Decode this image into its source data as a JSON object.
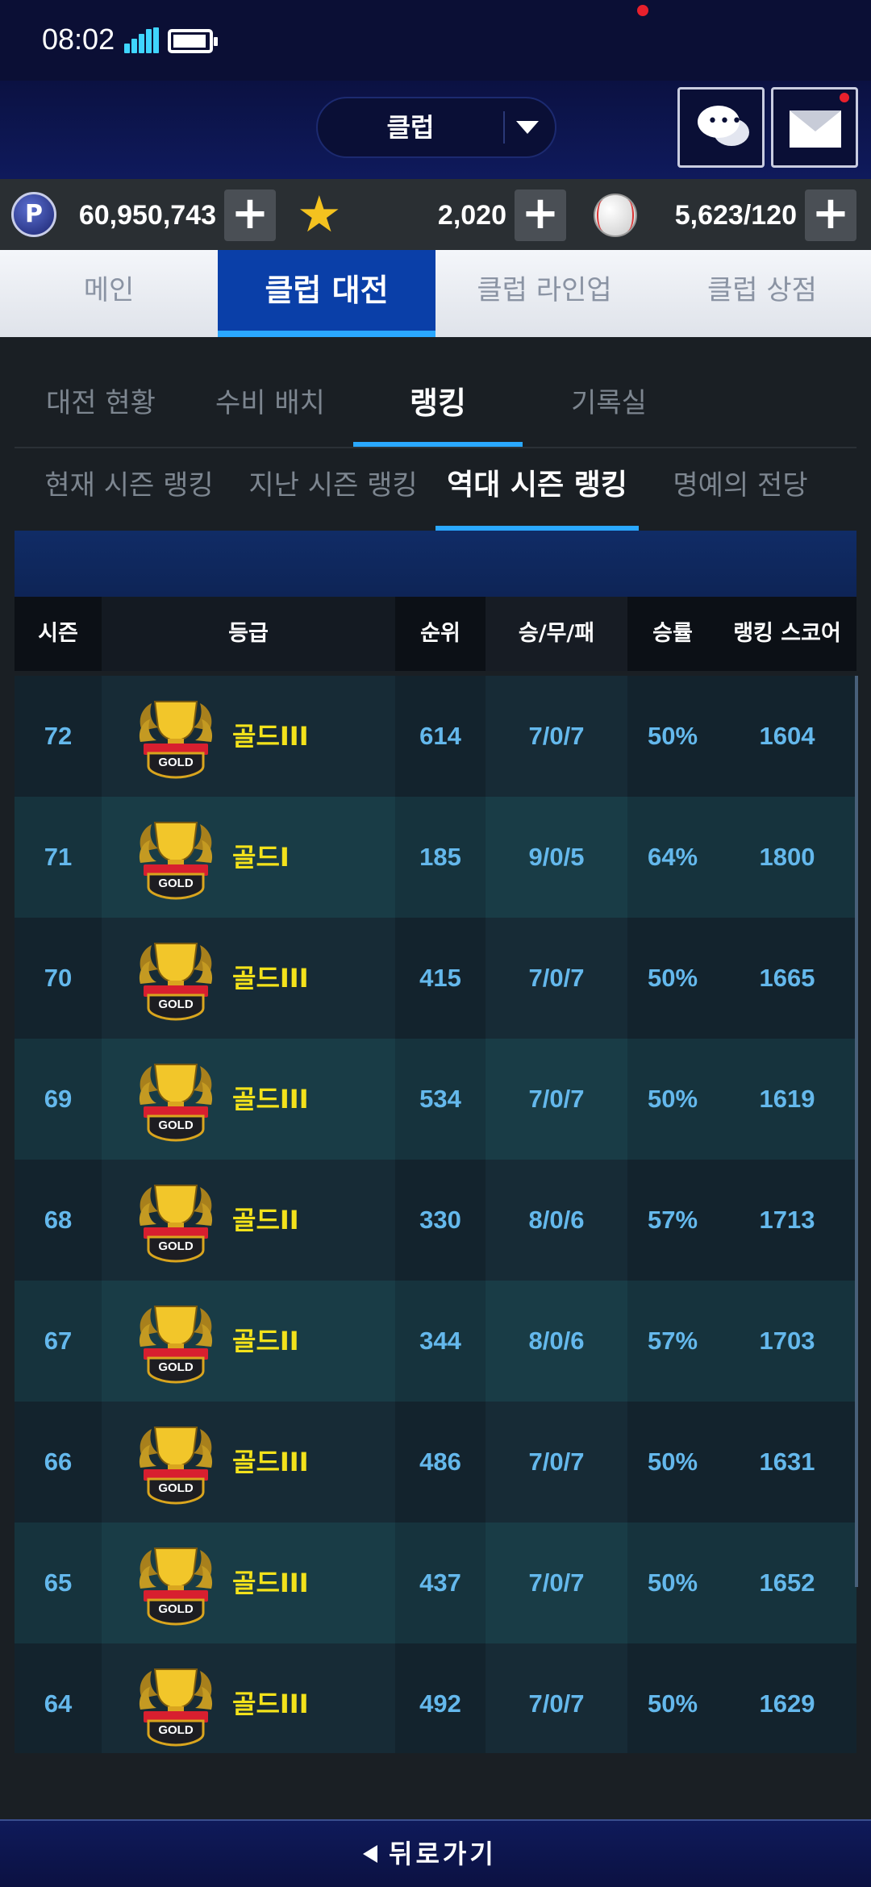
{
  "status": {
    "time": "08:02"
  },
  "header": {
    "club_select": "클럽"
  },
  "currency": {
    "points": "60,950,743",
    "stars": "2,020",
    "balls": "5,623/120"
  },
  "main_tabs": [
    "메인",
    "클럽 대전",
    "클럽 라인업",
    "클럽 상점"
  ],
  "sub_tabs": [
    "대전 현황",
    "수비 배치",
    "랭킹",
    "기록실"
  ],
  "ranking_tabs": [
    "현재 시즌 랭킹",
    "지난 시즌 랭킹",
    "역대 시즌 랭킹",
    "명예의 전당"
  ],
  "table": {
    "headers": [
      "시즌",
      "등급",
      "순위",
      "승/무/패",
      "승률",
      "랭킹 스코어"
    ],
    "rows": [
      {
        "season": "72",
        "grade": "골드III",
        "rank": "614",
        "wdl": "7/0/7",
        "rate": "50%",
        "score": "1604"
      },
      {
        "season": "71",
        "grade": "골드I",
        "rank": "185",
        "wdl": "9/0/5",
        "rate": "64%",
        "score": "1800"
      },
      {
        "season": "70",
        "grade": "골드III",
        "rank": "415",
        "wdl": "7/0/7",
        "rate": "50%",
        "score": "1665"
      },
      {
        "season": "69",
        "grade": "골드III",
        "rank": "534",
        "wdl": "7/0/7",
        "rate": "50%",
        "score": "1619"
      },
      {
        "season": "68",
        "grade": "골드II",
        "rank": "330",
        "wdl": "8/0/6",
        "rate": "57%",
        "score": "1713"
      },
      {
        "season": "67",
        "grade": "골드II",
        "rank": "344",
        "wdl": "8/0/6",
        "rate": "57%",
        "score": "1703"
      },
      {
        "season": "66",
        "grade": "골드III",
        "rank": "486",
        "wdl": "7/0/7",
        "rate": "50%",
        "score": "1631"
      },
      {
        "season": "65",
        "grade": "골드III",
        "rank": "437",
        "wdl": "7/0/7",
        "rate": "50%",
        "score": "1652"
      },
      {
        "season": "64",
        "grade": "골드III",
        "rank": "492",
        "wdl": "7/0/7",
        "rate": "50%",
        "score": "1629"
      }
    ]
  },
  "badge": {
    "text": "GOLD"
  },
  "footer": {
    "back_label": "뒤로가기"
  },
  "colors": {
    "accent": "#2aa8ff",
    "value_text": "#64b8ec",
    "grade_text": "#f3e21b",
    "active_tab": "#0a3fa8"
  }
}
